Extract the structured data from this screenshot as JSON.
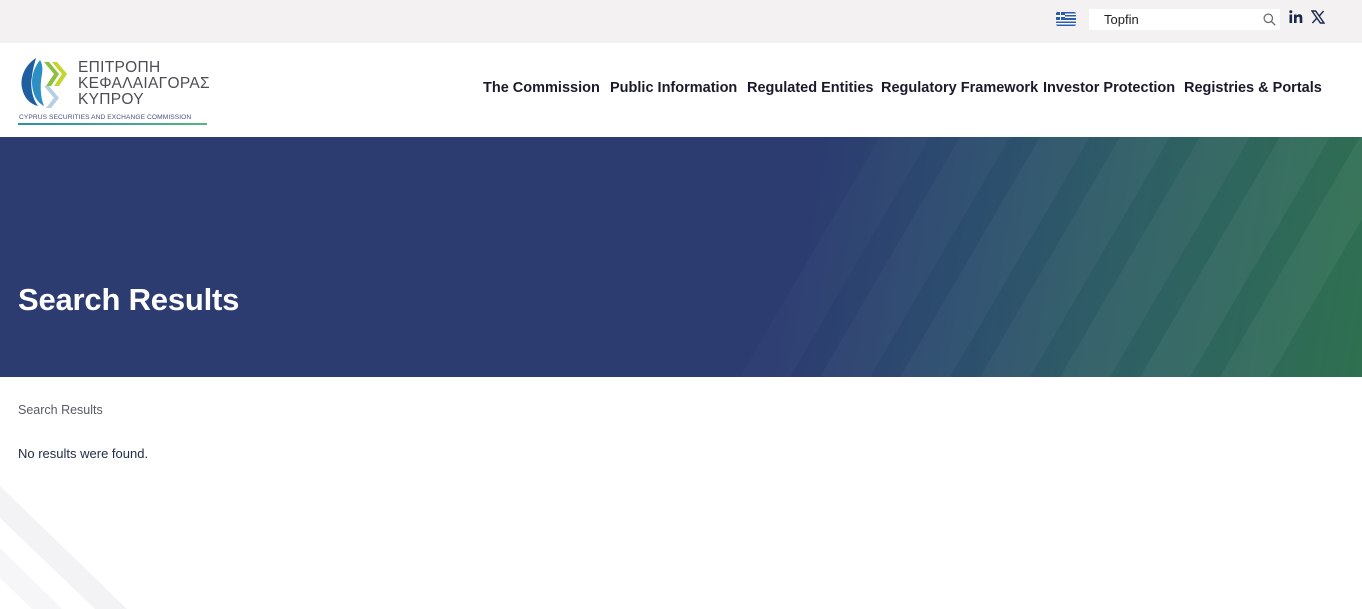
{
  "topbar": {
    "language_flag": "greek-flag-icon",
    "search": {
      "value": "Topfin",
      "placeholder": ""
    },
    "social": [
      "linkedin-icon",
      "x-icon"
    ]
  },
  "logo": {
    "greek_lines": [
      "ΕΠΙΤΡΟΠΗ",
      "ΚΕΦΑΛΑΙΑΓΟΡΑΣ",
      "ΚΥΠΡΟΥ"
    ],
    "english": "CYPRUS SECURITIES AND EXCHANGE COMMISSION"
  },
  "nav": {
    "items": [
      {
        "label": "The Commission"
      },
      {
        "label": "Public Information"
      },
      {
        "label": "Regulated Entities"
      },
      {
        "label": "Regulatory Framework"
      },
      {
        "label": "Investor Protection"
      },
      {
        "label": "Registries & Portals"
      }
    ]
  },
  "banner": {
    "title": "Search Results"
  },
  "content": {
    "breadcrumb": "Search Results",
    "message": "No results were found."
  },
  "colors": {
    "banner_navy": "#2c3b70",
    "banner_green": "#2f7050",
    "topbar_bg": "#f3f1f2",
    "text_dark": "#1f2a44"
  }
}
